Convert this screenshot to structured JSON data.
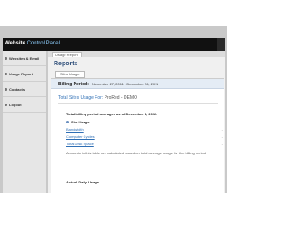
{
  "header": {
    "brand_prefix": "Website",
    "brand_accent": "Control Panel"
  },
  "sidebar": {
    "items": [
      {
        "label": "Websites & Email",
        "icon": "globe-icon"
      },
      {
        "label": "Usage Report",
        "icon": "chart-icon"
      },
      {
        "label": "Contacts",
        "icon": "contacts-icon"
      },
      {
        "label": "Logout",
        "icon": "logout-icon"
      }
    ]
  },
  "main": {
    "tab_label": "Usage Report",
    "page_title": "Reports",
    "subtab_label": "Sites Usage",
    "billing_label": "Billing Period:",
    "billing_value": "November 27, 2011 - December 26, 2011",
    "usage_title": "Total Sites Usage For:",
    "usage_project": "ProRed - DEMO",
    "average_line": "Total billing period averages as of December 8, 2011.",
    "rows": [
      {
        "label": "Site Usage",
        "value": "-"
      },
      {
        "label": "Bandwidth",
        "value": "-"
      },
      {
        "label": "Computer Cycles",
        "value": "-"
      },
      {
        "label": "Total Disk Space",
        "value": "-"
      }
    ],
    "note": "Amounts in this table are calculated based on total average usage for the billing period.",
    "actual_label": "Actual Daily Usage"
  }
}
